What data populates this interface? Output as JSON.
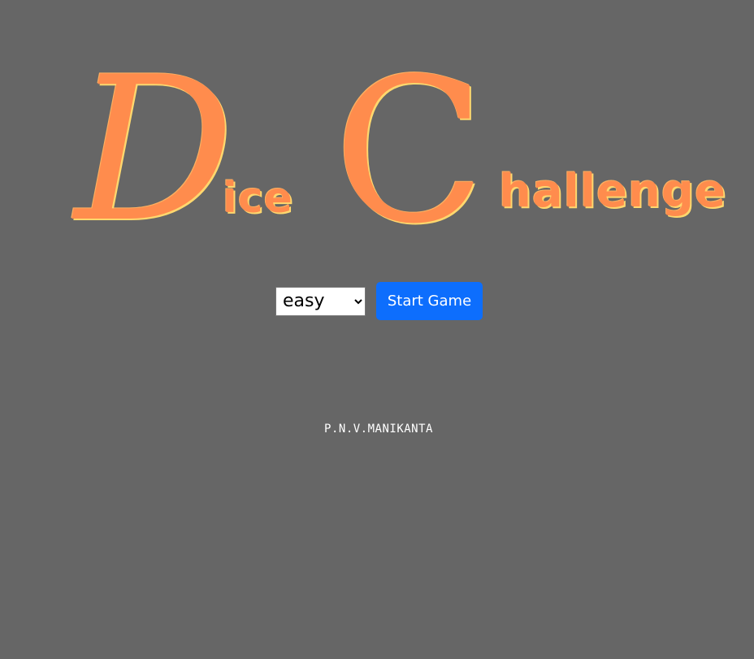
{
  "title": {
    "letter_d": "D",
    "word_ice": "ice",
    "letter_c": "C",
    "word_hallenge": "hallenge"
  },
  "controls": {
    "difficulty_selected": "easy",
    "start_button_label": "Start Game"
  },
  "footer": {
    "author": "P.N.V.MANIKANTA"
  },
  "colors": {
    "background": "#666666",
    "title_orange": "#ff8c4d",
    "title_outline": "#ffd86e",
    "button_blue": "#0d6efd"
  }
}
